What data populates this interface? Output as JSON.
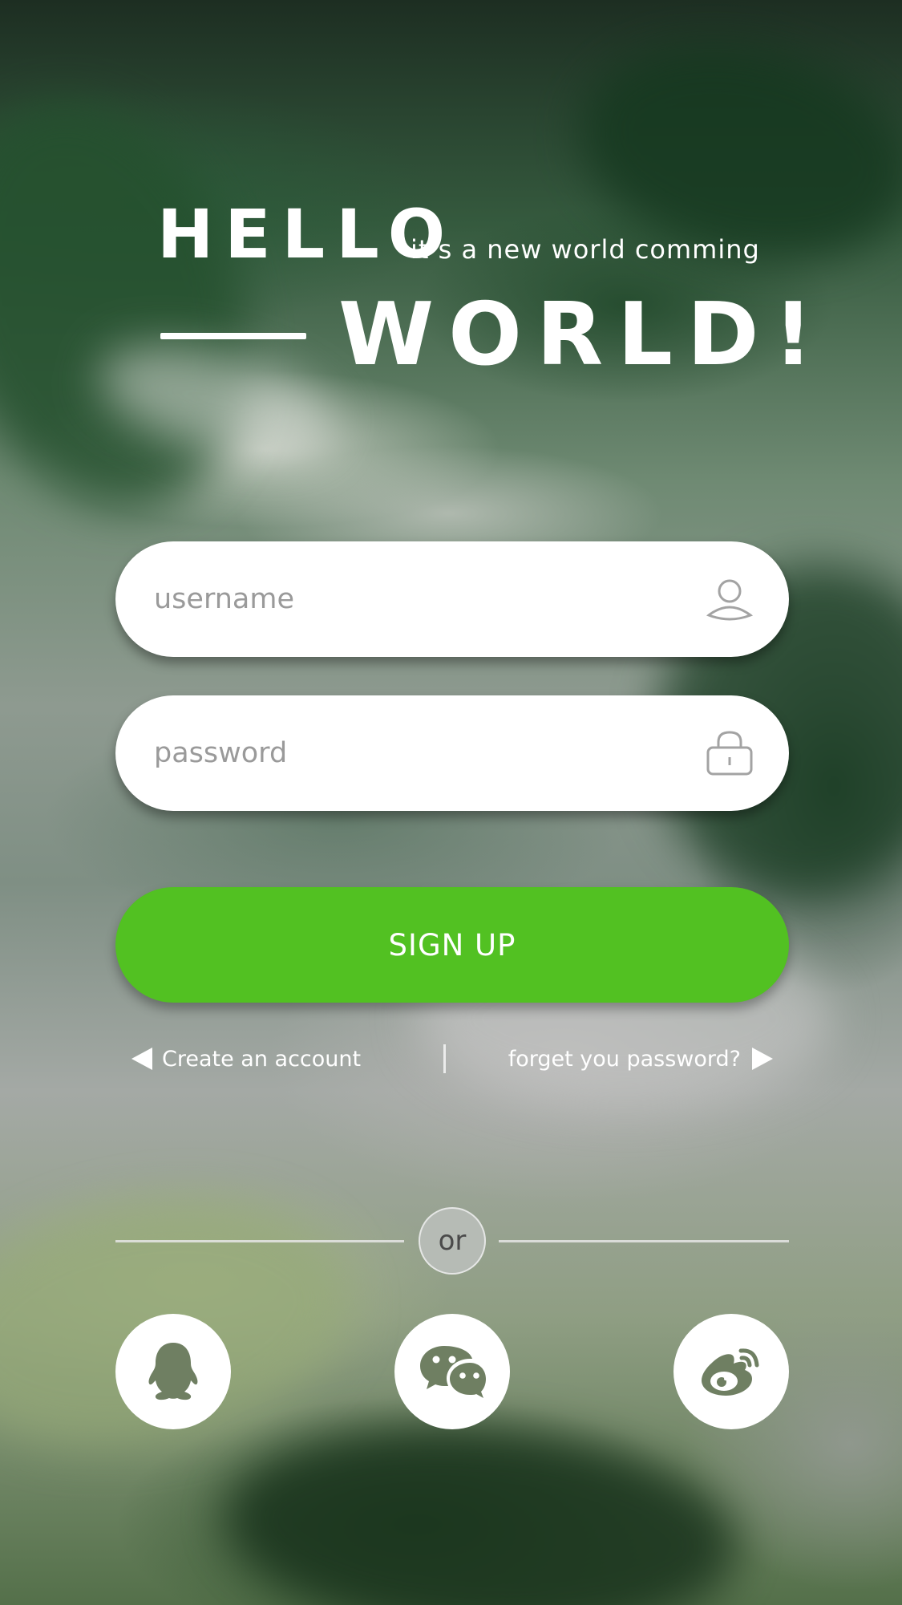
{
  "hero": {
    "hello": "HELLO",
    "tagline": "it’s a  new world comming",
    "world": "WORLD!"
  },
  "form": {
    "username": {
      "value": "",
      "placeholder": "username",
      "icon": "user-icon"
    },
    "password": {
      "value": "",
      "placeholder": "password",
      "icon": "lock-icon"
    }
  },
  "actions": {
    "signup_label": "SIGN UP",
    "create_account": "Create an account",
    "separator": "|",
    "forget_password": "forget you password?"
  },
  "divider": {
    "label": "or"
  },
  "social": [
    {
      "name": "qq",
      "icon": "qq-penguin-icon"
    },
    {
      "name": "wechat",
      "icon": "wechat-icon"
    },
    {
      "name": "weibo",
      "icon": "weibo-icon"
    }
  ],
  "colors": {
    "accent": "#52c122",
    "field_bg": "#ffffff",
    "placeholder": "#9a9a9a",
    "icon_gray": "#a3a3a3",
    "social_icon": "#6f7f62"
  }
}
